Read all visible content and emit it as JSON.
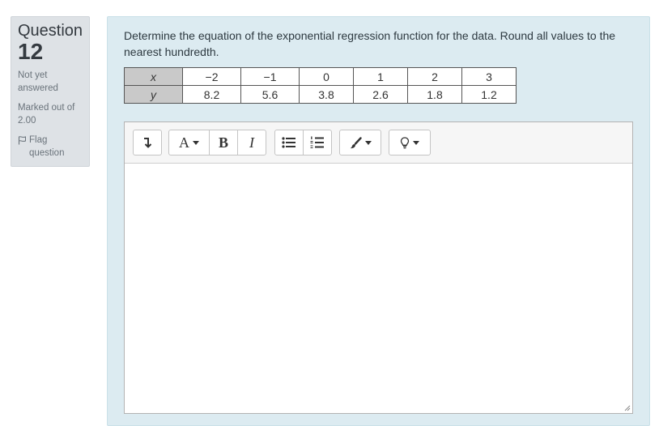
{
  "question_info": {
    "label": "Question",
    "number": "12",
    "state": "Not yet answered",
    "grade": "Marked out of 2.00",
    "flag_label": "Flag question"
  },
  "question": {
    "text": "Determine the equation of the exponential regression function for the data. Round all values to the nearest hundredth.",
    "table": {
      "x_label": "x",
      "y_label": "y",
      "x": [
        "−2",
        "−1",
        "0",
        "1",
        "2",
        "3"
      ],
      "y": [
        "8.2",
        "5.6",
        "3.8",
        "2.6",
        "1.8",
        "1.2"
      ]
    }
  },
  "editor": {
    "toolbar_icons": [
      "collapse-icon",
      "font-style-icon",
      "bold-icon",
      "italic-icon",
      "unordered-list-icon",
      "ordered-list-icon",
      "brush-icon",
      "lightbulb-icon"
    ],
    "bold_glyph": "B",
    "italic_glyph": "I",
    "font_glyph": "A",
    "value": ""
  },
  "colors": {
    "info_bg": "#dee2e6",
    "content_bg": "#dcebf1",
    "table_header_bg": "#c9c9c9"
  }
}
